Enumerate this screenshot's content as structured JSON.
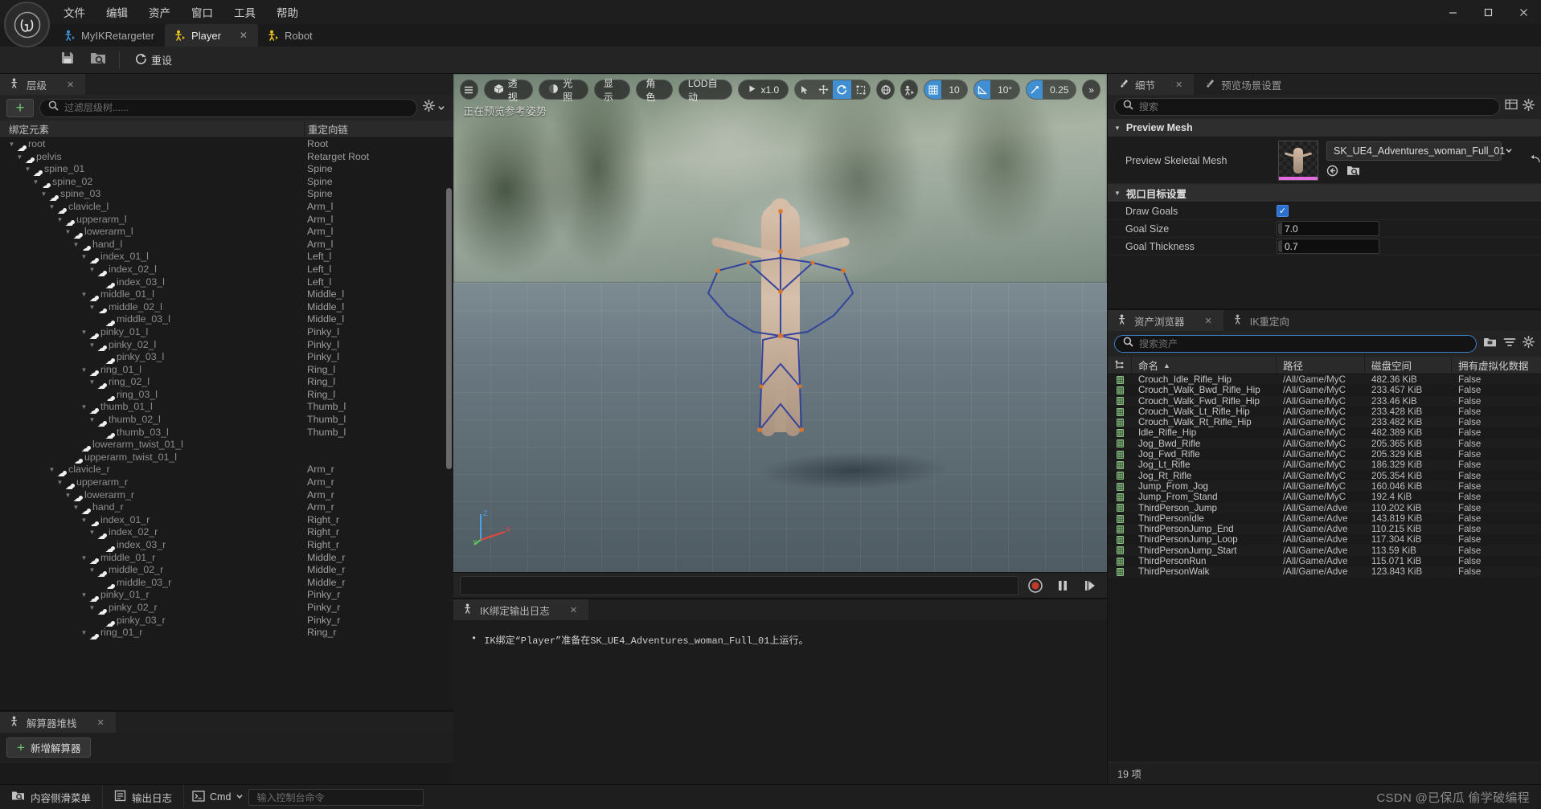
{
  "window": {
    "menu": [
      "文件",
      "编辑",
      "资产",
      "窗口",
      "工具",
      "帮助"
    ],
    "controls": {
      "minimize": "—",
      "maximize": "▢",
      "close": "✕"
    }
  },
  "tabs": [
    {
      "label": "MyIKRetargeter",
      "active": false,
      "icon": "retargeter-icon",
      "closable": false
    },
    {
      "label": "Player",
      "active": true,
      "icon": "ikrig-icon",
      "closable": true,
      "close": "✕"
    },
    {
      "label": "Robot",
      "active": false,
      "icon": "ikrig-icon",
      "closable": false
    }
  ],
  "toolbar": {
    "save_icon": "save-icon",
    "browse_icon": "browse-content-icon",
    "reset_label": "重设",
    "reset_icon": "reset-icon"
  },
  "hierarchy": {
    "tab_label": "层级",
    "tab_close": "✕",
    "add_label": "+",
    "search_placeholder": "过滤层级树......",
    "search_value": "",
    "settings_icon": "gear-icon",
    "chevron_icon": "chevron-down-icon",
    "columns": [
      "绑定元素",
      "重定向链"
    ],
    "rows": [
      {
        "name": "root",
        "chain": "Root",
        "depth": 0,
        "expanded": true
      },
      {
        "name": "pelvis",
        "chain": "Retarget Root",
        "depth": 1,
        "expanded": true
      },
      {
        "name": "spine_01",
        "chain": "Spine",
        "depth": 2,
        "expanded": true
      },
      {
        "name": "spine_02",
        "chain": "Spine",
        "depth": 3,
        "expanded": true
      },
      {
        "name": "spine_03",
        "chain": "Spine",
        "depth": 4,
        "expanded": true
      },
      {
        "name": "clavicle_l",
        "chain": "Arm_l",
        "depth": 5,
        "expanded": true
      },
      {
        "name": "upperarm_l",
        "chain": "Arm_l",
        "depth": 6,
        "expanded": true
      },
      {
        "name": "lowerarm_l",
        "chain": "Arm_l",
        "depth": 7,
        "expanded": true
      },
      {
        "name": "hand_l",
        "chain": "Arm_l",
        "depth": 8,
        "expanded": true
      },
      {
        "name": "index_01_l",
        "chain": "Left_l",
        "depth": 9,
        "expanded": true
      },
      {
        "name": "index_02_l",
        "chain": "Left_l",
        "depth": 10,
        "expanded": true
      },
      {
        "name": "index_03_l",
        "chain": "Left_l",
        "depth": 11,
        "expanded": false
      },
      {
        "name": "middle_01_l",
        "chain": "Middle_l",
        "depth": 9,
        "expanded": true
      },
      {
        "name": "middle_02_l",
        "chain": "Middle_l",
        "depth": 10,
        "expanded": true
      },
      {
        "name": "middle_03_l",
        "chain": "Middle_l",
        "depth": 11,
        "expanded": false
      },
      {
        "name": "pinky_01_l",
        "chain": "Pinky_l",
        "depth": 9,
        "expanded": true
      },
      {
        "name": "pinky_02_l",
        "chain": "Pinky_l",
        "depth": 10,
        "expanded": true
      },
      {
        "name": "pinky_03_l",
        "chain": "Pinky_l",
        "depth": 11,
        "expanded": false
      },
      {
        "name": "ring_01_l",
        "chain": "Ring_l",
        "depth": 9,
        "expanded": true
      },
      {
        "name": "ring_02_l",
        "chain": "Ring_l",
        "depth": 10,
        "expanded": true
      },
      {
        "name": "ring_03_l",
        "chain": "Ring_l",
        "depth": 11,
        "expanded": false
      },
      {
        "name": "thumb_01_l",
        "chain": "Thumb_l",
        "depth": 9,
        "expanded": true
      },
      {
        "name": "thumb_02_l",
        "chain": "Thumb_l",
        "depth": 10,
        "expanded": true
      },
      {
        "name": "thumb_03_l",
        "chain": "Thumb_l",
        "depth": 11,
        "expanded": false
      },
      {
        "name": "lowerarm_twist_01_l",
        "chain": "",
        "depth": 8,
        "expanded": false
      },
      {
        "name": "upperarm_twist_01_l",
        "chain": "",
        "depth": 7,
        "expanded": false
      },
      {
        "name": "clavicle_r",
        "chain": "Arm_r",
        "depth": 5,
        "expanded": true
      },
      {
        "name": "upperarm_r",
        "chain": "Arm_r",
        "depth": 6,
        "expanded": true
      },
      {
        "name": "lowerarm_r",
        "chain": "Arm_r",
        "depth": 7,
        "expanded": true
      },
      {
        "name": "hand_r",
        "chain": "Arm_r",
        "depth": 8,
        "expanded": true
      },
      {
        "name": "index_01_r",
        "chain": "Right_r",
        "depth": 9,
        "expanded": true
      },
      {
        "name": "index_02_r",
        "chain": "Right_r",
        "depth": 10,
        "expanded": true
      },
      {
        "name": "index_03_r",
        "chain": "Right_r",
        "depth": 11,
        "expanded": false
      },
      {
        "name": "middle_01_r",
        "chain": "Middle_r",
        "depth": 9,
        "expanded": true
      },
      {
        "name": "middle_02_r",
        "chain": "Middle_r",
        "depth": 10,
        "expanded": true
      },
      {
        "name": "middle_03_r",
        "chain": "Middle_r",
        "depth": 11,
        "expanded": false
      },
      {
        "name": "pinky_01_r",
        "chain": "Pinky_r",
        "depth": 9,
        "expanded": true
      },
      {
        "name": "pinky_02_r",
        "chain": "Pinky_r",
        "depth": 10,
        "expanded": true
      },
      {
        "name": "pinky_03_r",
        "chain": "Pinky_r",
        "depth": 11,
        "expanded": false
      },
      {
        "name": "ring_01_r",
        "chain": "Ring_r",
        "depth": 9,
        "expanded": true
      }
    ]
  },
  "solver": {
    "tab_label": "解算器堆栈",
    "tab_close": "✕",
    "add_label": "新增解算器",
    "add_plus": "+"
  },
  "viewport": {
    "menu_icon": "hamburger-icon",
    "perspective_label": "透视",
    "perspective_icon": "cube-icon",
    "lighting_label": "光照",
    "lighting_icon": "sphere-icon",
    "show_label": "显示",
    "character_label": "角色",
    "lod_label": "LOD自动",
    "playrate_label": "x1.0",
    "playrate_icon": "play-icon",
    "transform_tools": [
      {
        "icon": "select-arrow-icon",
        "active": false
      },
      {
        "icon": "translate-icon",
        "active": false
      },
      {
        "icon": "rotate-icon",
        "active": true
      },
      {
        "icon": "scale-icon",
        "active": false
      }
    ],
    "coord_icon": "world-coord-icon",
    "surface_icon": "surface-snap-icon",
    "grid_snap_icon": "grid-icon",
    "grid_snap_value": "10",
    "angle_snap_icon": "angle-icon",
    "angle_snap_value": "10°",
    "scale_snap_icon": "scale-snap-icon",
    "scale_snap_value": "0.25",
    "overflow": "»",
    "status_text": "正在预览参考姿势",
    "axis_labels": {
      "z": "Z",
      "y": "Y",
      "x": "X"
    }
  },
  "playback": {
    "record_icon": "record-icon",
    "pause_icon": "pause-icon",
    "step_icon": "step-forward-icon"
  },
  "log": {
    "tab_label": "IK绑定输出日志",
    "tab_close": "✕",
    "bullet": "•",
    "message": "IK绑定“Player”准备在SK_UE4_Adventures_woman_Full_01上运行。"
  },
  "details": {
    "tab_label": "细节",
    "tab_close": "✕",
    "tab2_label": "预览场景设置",
    "search_placeholder": "搜索",
    "search_value": "",
    "columns_icon": "columns-icon",
    "settings_icon": "gear-icon",
    "sections": [
      {
        "title": "Preview Mesh",
        "type": "mesh",
        "rows": [
          {
            "label": "Preview Skeletal Mesh",
            "value": "SK_UE4_Adventures_woman_Full_01",
            "dropdown_icon": "chevron-down-icon",
            "browse_icon": "browse-icon",
            "find_icon": "find-in-content-icon",
            "reset_icon": "revert-icon"
          }
        ]
      },
      {
        "title": "视口目标设置",
        "type": "props",
        "rows": [
          {
            "label": "Draw Goals",
            "kind": "checkbox",
            "checked": true,
            "value": "✓"
          },
          {
            "label": "Goal Size",
            "kind": "number",
            "value": "7.0"
          },
          {
            "label": "Goal Thickness",
            "kind": "number",
            "value": "0.7"
          }
        ]
      }
    ]
  },
  "asset_browser": {
    "tab_label": "资产浏览器",
    "tab_close": "✕",
    "tab2_label": "IK重定向",
    "search_placeholder": "搜索资产",
    "search_value": "",
    "folder_icon": "folder-icon",
    "filter_icon": "filter-icon",
    "settings_icon": "gear-icon",
    "columns": [
      "",
      "命名",
      "路径",
      "磁盘空间",
      "拥有虚拟化数据"
    ],
    "sort_indicator": "▲",
    "tree_icon": "hierarchy-icon",
    "count_label": "19 项",
    "rows": [
      {
        "name": "Crouch_Idle_Rifle_Hip",
        "path": "/All/Game/MyC",
        "size": "482.36 KiB",
        "virtualized": "False"
      },
      {
        "name": "Crouch_Walk_Bwd_Rifle_Hip",
        "path": "/All/Game/MyC",
        "size": "233.457 KiB",
        "virtualized": "False"
      },
      {
        "name": "Crouch_Walk_Fwd_Rifle_Hip",
        "path": "/All/Game/MyC",
        "size": "233.46 KiB",
        "virtualized": "False"
      },
      {
        "name": "Crouch_Walk_Lt_Rifle_Hip",
        "path": "/All/Game/MyC",
        "size": "233.428 KiB",
        "virtualized": "False"
      },
      {
        "name": "Crouch_Walk_Rt_Rifle_Hip",
        "path": "/All/Game/MyC",
        "size": "233.482 KiB",
        "virtualized": "False"
      },
      {
        "name": "Idle_Rifle_Hip",
        "path": "/All/Game/MyC",
        "size": "482.389 KiB",
        "virtualized": "False"
      },
      {
        "name": "Jog_Bwd_Rifle",
        "path": "/All/Game/MyC",
        "size": "205.365 KiB",
        "virtualized": "False"
      },
      {
        "name": "Jog_Fwd_Rifle",
        "path": "/All/Game/MyC",
        "size": "205.329 KiB",
        "virtualized": "False"
      },
      {
        "name": "Jog_Lt_Rifle",
        "path": "/All/Game/MyC",
        "size": "186.329 KiB",
        "virtualized": "False"
      },
      {
        "name": "Jog_Rt_Rifle",
        "path": "/All/Game/MyC",
        "size": "205.354 KiB",
        "virtualized": "False"
      },
      {
        "name": "Jump_From_Jog",
        "path": "/All/Game/MyC",
        "size": "160.046 KiB",
        "virtualized": "False"
      },
      {
        "name": "Jump_From_Stand",
        "path": "/All/Game/MyC",
        "size": "192.4 KiB",
        "virtualized": "False"
      },
      {
        "name": "ThirdPerson_Jump",
        "path": "/All/Game/Adve",
        "size": "110.202 KiB",
        "virtualized": "False"
      },
      {
        "name": "ThirdPersonIdle",
        "path": "/All/Game/Adve",
        "size": "143.819 KiB",
        "virtualized": "False"
      },
      {
        "name": "ThirdPersonJump_End",
        "path": "/All/Game/Adve",
        "size": "110.215 KiB",
        "virtualized": "False"
      },
      {
        "name": "ThirdPersonJump_Loop",
        "path": "/All/Game/Adve",
        "size": "117.304 KiB",
        "virtualized": "False"
      },
      {
        "name": "ThirdPersonJump_Start",
        "path": "/All/Game/Adve",
        "size": "113.59 KiB",
        "virtualized": "False"
      },
      {
        "name": "ThirdPersonRun",
        "path": "/All/Game/Adve",
        "size": "115.071 KiB",
        "virtualized": "False"
      },
      {
        "name": "ThirdPersonWalk",
        "path": "/All/Game/Adve",
        "size": "123.843 KiB",
        "virtualized": "False"
      }
    ]
  },
  "statusbar": {
    "content_drawer_label": "内容侧滑菜单",
    "content_drawer_icon": "drawer-icon",
    "output_log_label": "输出日志",
    "output_log_icon": "log-icon",
    "cmd_label": "Cmd",
    "cmd_icon": "console-icon",
    "cmd_chevron": "chevron-down-icon",
    "cmd_placeholder": "输入控制台命令",
    "watermark": "CSDN @已保瓜 偷学破编程"
  },
  "colors": {
    "accent_blue": "#3f8fd2",
    "green_plus": "#6ec46e",
    "annotation_red": "#e8140c",
    "tab_active_bg": "#2b2b2b",
    "panel_bg": "#1c1c1c"
  }
}
